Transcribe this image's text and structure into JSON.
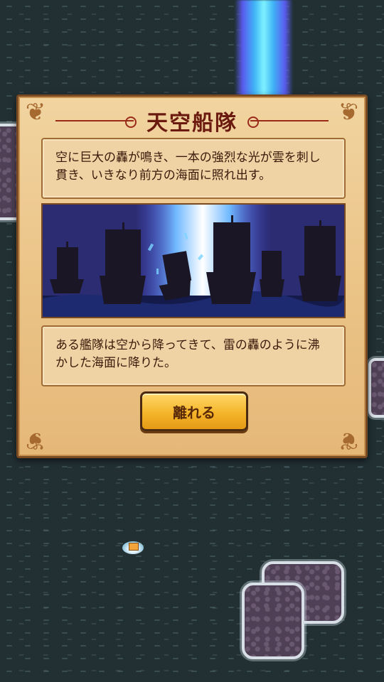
{
  "event": {
    "title": "天空船隊",
    "text_top": "空に巨大の轟が鳴き、一本の強烈な光が雲を刺し貫き、いきなり前方の海面に照れ出す。",
    "text_bottom": "ある艦隊は空から降ってきて、雷の轟のように沸かした海面に降りた。",
    "leave_button": "離れる"
  },
  "colors": {
    "sea": "#223034",
    "parchment": "#ebc488",
    "frame": "#7a4a22",
    "title_text": "#6b1a10",
    "button": "#f5b52a",
    "light_beam": "#7ff3ff"
  },
  "icons": {
    "corner_ornament": "scroll-ornament-icon",
    "raft": "raft-icon"
  }
}
